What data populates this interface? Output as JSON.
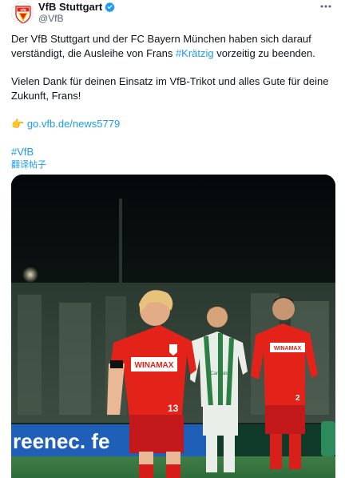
{
  "author": {
    "display_name": "VfB Stuttgart",
    "handle": "@VfB",
    "avatar_icon": "vfb-crest-icon",
    "avatar_text": "VfB",
    "verified": true
  },
  "menu": {
    "more_icon": "more-horizontal-icon"
  },
  "tweet": {
    "para1_before": "Der VfB Stuttgart und der FC Bayern München haben sich darauf verständigt, die Ausleihe von Frans ",
    "para1_hashtag": "#Krätzig",
    "para1_after": " vorzeitig zu beenden.",
    "para2": "Vielen Dank für deinen Einsatz im VfB-Trikot und alles Gute für deine Zukunft, Frans!",
    "link_emoji": "👉",
    "link_url": "go.vfb.de/news5779",
    "hashtag": "#VfB"
  },
  "translate_label": "翻译帖子",
  "media": {
    "alt_description": "football-match-photo",
    "banner_text": "reenec. fe",
    "shirt_sponsor_1": "WINAMAX",
    "shirt_sponsor_2": "WINAMAX",
    "away_sponsor": "Cannabis",
    "shirt_number_1": "13",
    "shirt_number_2": "2"
  },
  "colors": {
    "link": "#1d9bf0",
    "text": "#0f1419",
    "muted": "#536471",
    "vfb_red": "#e32219",
    "pitch_green": "#2e6b3a",
    "banner_blue": "#1f5fb8"
  }
}
